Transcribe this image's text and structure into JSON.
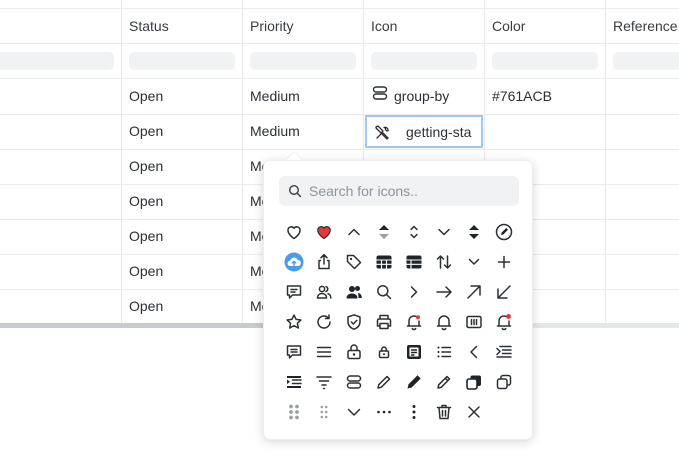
{
  "columns": [
    "Status",
    "Priority",
    "Icon",
    "Color",
    "Reference"
  ],
  "rows": [
    {
      "status": "Open",
      "priority": "Medium",
      "icon_label": "group-by",
      "color": "#761ACB"
    },
    {
      "status": "Open",
      "priority": "Medium",
      "icon_label": "",
      "color": ""
    },
    {
      "status": "Open",
      "priority": "Me",
      "icon_label": "",
      "color": ""
    },
    {
      "status": "Open",
      "priority": "Me",
      "icon_label": "",
      "color": ""
    },
    {
      "status": "Open",
      "priority": "Me",
      "icon_label": "",
      "color": ""
    },
    {
      "status": "Open",
      "priority": "Me",
      "icon_label": "",
      "color": ""
    },
    {
      "status": "Open",
      "priority": "Me",
      "icon_label": "",
      "color": ""
    }
  ],
  "editor": {
    "value": "getting-sta"
  },
  "picker": {
    "search_placeholder": "Search for icons..",
    "icons": [
      [
        "heart-outline-icon",
        "heart-filled-icon",
        "chevron-up-icon",
        "sort-filled-icon",
        "chevron-up-down-icon",
        "chevron-down-icon",
        "sort-solid-icon",
        "edit-circle-icon"
      ],
      [
        "cloud-upload-icon",
        "share-icon",
        "tag-icon",
        "table-filled-icon",
        "list-table-icon",
        "sort-arrows-icon",
        "chevron-down-small-icon",
        "plus-icon"
      ],
      [
        "comment-icon",
        "users-outline-icon",
        "users-filled-icon",
        "search-icon",
        "chevron-right-icon",
        "arrow-right-icon",
        "arrow-up-right-icon",
        "arrow-down-left-icon"
      ],
      [
        "star-icon",
        "refresh-icon",
        "shield-check-icon",
        "printer-icon",
        "bell-dot-icon",
        "bell-icon",
        "text-box-icon",
        "bell-badge-icon"
      ],
      [
        "comment-lines-icon",
        "menu-icon",
        "lock-icon",
        "lock-small-icon",
        "document-filled-icon",
        "bullet-list-icon",
        "chevron-left-icon",
        "indent-icon"
      ],
      [
        "outdent-icon",
        "filter-icon",
        "group-by-icon",
        "pencil-icon",
        "pencil-filled-icon",
        "pencil-outline-icon",
        "copy-filled-icon",
        "copy-icon"
      ],
      [
        "drag-handle-icon",
        "drag-handle-small-icon",
        "chevron-down-thin-icon",
        "more-horizontal-icon",
        "more-vertical-icon",
        "trash-icon",
        "close-icon"
      ]
    ]
  }
}
